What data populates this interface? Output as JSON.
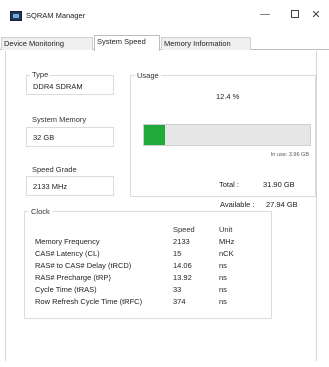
{
  "window": {
    "title": "SQRAM Manager",
    "minimize_glyph": "—",
    "close_glyph": "✕"
  },
  "tabs": [
    {
      "label": "Device Monitoring",
      "active": false
    },
    {
      "label": "System Speed",
      "active": true
    },
    {
      "label": "Memory Information",
      "active": false
    }
  ],
  "type": {
    "label": "Type",
    "value": "DDR4 SDRAM"
  },
  "system_memory": {
    "label": "System Memory",
    "value": "32 GB"
  },
  "speed_grade": {
    "label": "Speed Grade",
    "value": "2133 MHz"
  },
  "usage": {
    "label": "Usage",
    "percent_text": "12.4 %",
    "percent_value": 12.4,
    "in_use_text": "In use: 3.96 GB",
    "total_label": "Total :",
    "total_value": "31.90 GB",
    "available_label": "Available :",
    "available_value": "27.94 GB",
    "bar_color": "#1faa3a"
  },
  "clock": {
    "label": "Clock",
    "columns": [
      "",
      "Speed",
      "Unit"
    ],
    "rows": [
      {
        "name": "Memory Frequency",
        "speed": "2133",
        "unit": "MHz"
      },
      {
        "name": "CAS# Latency (CL)",
        "speed": "15",
        "unit": "nCK"
      },
      {
        "name": "RAS# to CAS# Delay (tRCD)",
        "speed": "14.06",
        "unit": "ns"
      },
      {
        "name": "RAS# Precharge (tRP)",
        "speed": "13.92",
        "unit": "ns"
      },
      {
        "name": "Cycle Time (tRAS)",
        "speed": "33",
        "unit": "ns"
      },
      {
        "name": "Row Refresh Cycle Time (tRFC)",
        "speed": "374",
        "unit": "ns"
      }
    ]
  }
}
